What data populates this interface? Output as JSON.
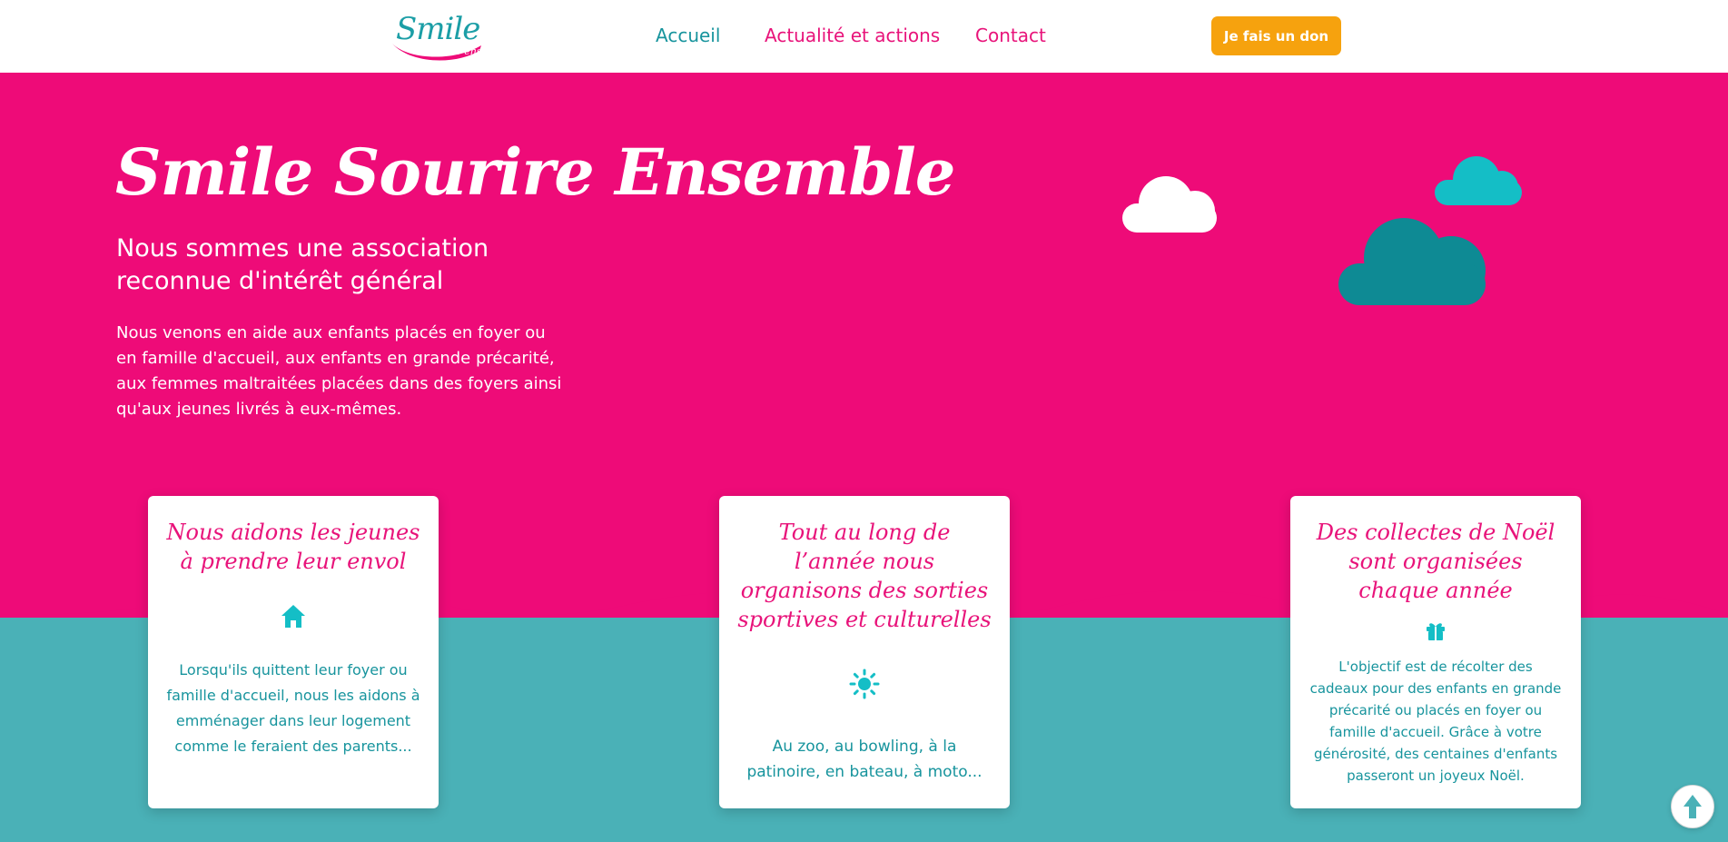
{
  "logo": {
    "name": "Smile",
    "tagline": "Sourire ensemble"
  },
  "nav": {
    "items": [
      {
        "label": "Accueil",
        "active": true
      },
      {
        "label": "Actualité et actions",
        "active": false
      },
      {
        "label": "Contact",
        "active": false
      }
    ],
    "donate_label": "Je fais un don"
  },
  "hero": {
    "title": "Smile Sourire Ensemble",
    "subtitle": "Nous sommes une association reconnue d'intérêt général",
    "text": "Nous venons en aide aux enfants placés en foyer ou en famille d'accueil, aux enfants en grande précarité, aux femmes maltraitées placées dans des foyers ainsi qu'aux jeunes livrés à eux-mêmes."
  },
  "cards": [
    {
      "title": "Nous aidons les jeunes à prendre leur envol",
      "icon": "home-icon",
      "text": "Lorsqu'ils quittent leur foyer ou famille d'accueil, nous les aidons à emménager dans leur logement comme le feraient des parents..."
    },
    {
      "title": "Tout au long de l’année nous organisons des sorties sportives et culturelles",
      "icon": "sun-icon",
      "text": "Au zoo, au bowling, à la patinoire, en bateau, à moto..."
    },
    {
      "title": "Des collectes de Noël sont organisées chaque année",
      "icon": "gift-icon",
      "text": "L'objectif est de récolter des cadeaux pour des enfants en grande précarité ou placés en foyer ou famille d'accueil. Grâce à votre générosité, des centaines d'enfants passeront un joyeux Noël."
    }
  ],
  "colors": {
    "pink": "#ee0b78",
    "teal": "#4ab1b7",
    "teal_text": "#17949d",
    "orange": "#f6a20e",
    "cloud_white": "#ffffff",
    "cloud_cyan": "#14bec6",
    "cloud_dark": "#0e8a94"
  },
  "scroll_top_icon": "arrow-up-icon"
}
